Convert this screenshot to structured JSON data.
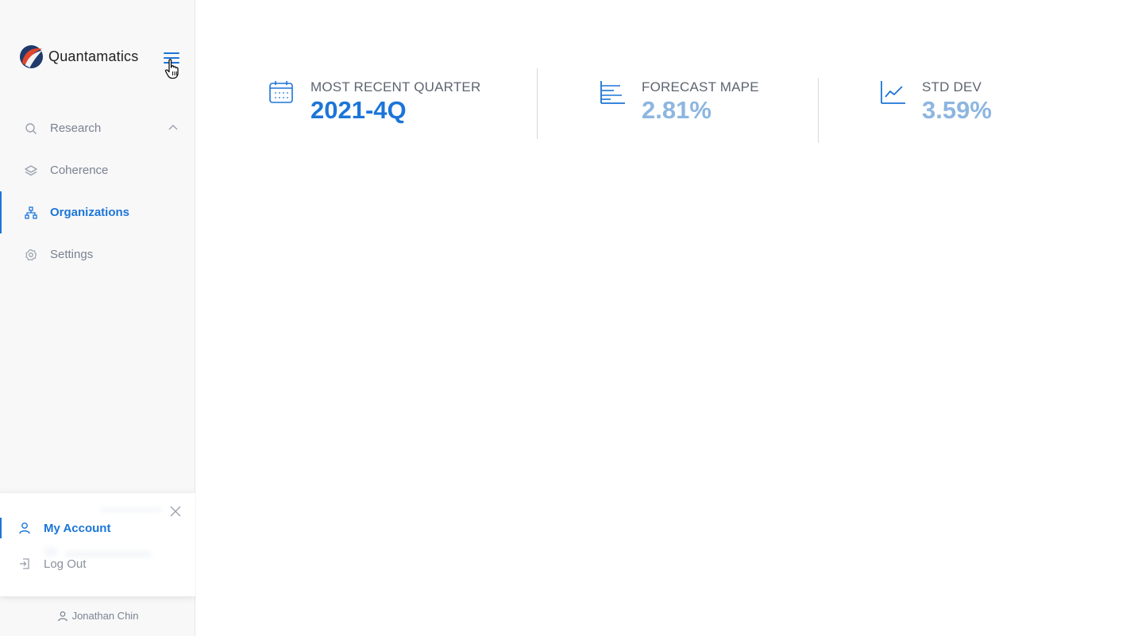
{
  "app": {
    "name": "Quantamatics"
  },
  "colors": {
    "accent": "#1c75d8",
    "accent_light": "#8db6e0",
    "muted_text": "#7a8290"
  },
  "sidebar": {
    "items": [
      {
        "label": "Research",
        "icon": "search-icon",
        "expanded": true
      },
      {
        "label": "Coherence",
        "icon": "layers-icon"
      },
      {
        "label": "Organizations",
        "icon": "sitemap-icon",
        "active": true
      },
      {
        "label": "Settings",
        "icon": "gear-icon"
      }
    ]
  },
  "account_menu": {
    "items": [
      {
        "label": "My Account",
        "icon": "user-icon",
        "active": true
      },
      {
        "label": "Log Out",
        "icon": "logout-icon"
      }
    ]
  },
  "user": {
    "name": "Jonathan Chin"
  },
  "stats": [
    {
      "label": "MOST RECENT QUARTER",
      "value": "2021-4Q",
      "icon": "calendar-icon"
    },
    {
      "label": "FORECAST MAPE",
      "value": "2.81%",
      "icon": "bar-lines-icon"
    },
    {
      "label": "STD DEV",
      "value": "3.59%",
      "icon": "line-chart-icon"
    }
  ]
}
